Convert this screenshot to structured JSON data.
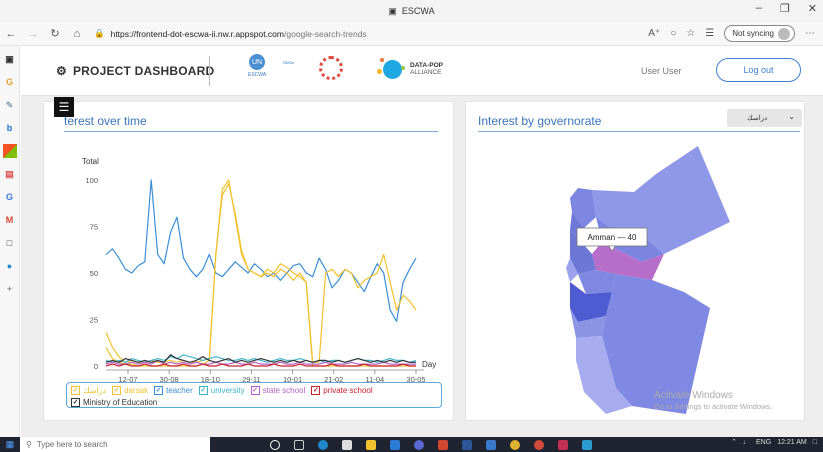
{
  "browser": {
    "tab_title": "ESCWA",
    "url_host": "https://frontend-dot-escwa-ii.nw.r.appspot.com",
    "url_path": "/google-search-trends",
    "not_syncing": "Not syncing"
  },
  "header": {
    "brand": "PROJECT DASHBOARD",
    "dp_title": "DATA-POP",
    "dp_sub": "ALLIANCE",
    "user": "User User",
    "logout": "Log out"
  },
  "card_time": {
    "title": "terest over time"
  },
  "card_gov": {
    "title": "Interest by governorate",
    "select_value": "دراسك",
    "tooltip": "Amman — 40"
  },
  "watermark": {
    "title": "Activate Windows",
    "sub": "Go to Settings to activate Windows."
  },
  "taskbar": {
    "search_placeholder": "Type here to search",
    "time": "12:21 AM",
    "lang": "ENG"
  },
  "colors": {
    "accent": "#3a74b8",
    "teacher": "#3b8fd6",
    "darsak": "#f2c12e",
    "university": "#3fb3c9",
    "state_school": "#b55fc8",
    "private_school": "#c8202f",
    "ministry": "#333333",
    "arabic": "#f2c12e"
  },
  "chart_data": {
    "type": "line",
    "ylabel": "Total",
    "xlabel": "Day",
    "ylim": [
      0,
      100
    ],
    "yticks": [
      0,
      25,
      50,
      75,
      100
    ],
    "x_tick_labels": [
      "12-07",
      "30-08",
      "18-10",
      "29-11",
      "10-01",
      "21-02",
      "11-04",
      "30-05"
    ],
    "legend": [
      "دراسك",
      "darsak",
      "teacher",
      "university",
      "state school",
      "private school",
      "Ministry of Education"
    ],
    "series": [
      {
        "name": "teacher",
        "values": [
          60,
          63,
          58,
          52,
          50,
          54,
          56,
          100,
          60,
          55,
          72,
          80,
          58,
          52,
          48,
          52,
          60,
          50,
          48,
          52,
          56,
          53,
          50,
          55,
          52,
          48,
          50,
          46,
          50,
          54,
          55,
          50,
          48,
          58,
          52,
          42,
          46,
          52,
          50,
          45,
          40,
          48,
          55,
          50,
          30,
          24,
          45,
          52,
          58
        ]
      },
      {
        "name": "دراسك",
        "values": [
          10,
          4,
          2,
          1,
          1,
          0,
          0,
          0,
          0,
          0,
          0,
          0,
          0,
          0,
          0,
          1,
          3,
          60,
          95,
          100,
          80,
          60,
          52,
          50,
          48,
          50,
          48,
          52,
          50,
          46,
          50,
          45,
          0,
          0,
          0,
          0,
          0,
          0,
          0,
          0,
          0,
          0,
          0,
          0,
          0,
          0,
          0,
          0,
          0
        ]
      },
      {
        "name": "darsak",
        "values": [
          18,
          10,
          5,
          2,
          3,
          2,
          2,
          3,
          2,
          2,
          3,
          2,
          3,
          2,
          2,
          3,
          4,
          60,
          92,
          98,
          82,
          62,
          52,
          50,
          48,
          52,
          50,
          55,
          53,
          50,
          48,
          45,
          2,
          2,
          50,
          52,
          48,
          52,
          50,
          42,
          46,
          48,
          50,
          60,
          45,
          30,
          38,
          35,
          30
        ]
      },
      {
        "name": "university",
        "values": [
          3,
          2,
          3,
          2,
          4,
          3,
          2,
          3,
          4,
          3,
          5,
          4,
          6,
          5,
          4,
          3,
          4,
          5,
          4,
          3,
          3,
          4,
          3,
          4,
          3,
          2,
          3,
          4,
          3,
          3,
          4,
          3,
          2,
          3,
          2,
          3,
          3,
          2,
          3,
          4,
          3,
          3,
          2,
          3,
          4,
          3,
          3,
          2,
          3
        ]
      },
      {
        "name": "state school",
        "values": [
          1,
          2,
          1,
          1,
          2,
          1,
          2,
          1,
          3,
          1,
          2,
          1,
          2,
          1,
          2,
          1,
          1,
          2,
          1,
          1,
          2,
          1,
          1,
          2,
          1,
          1,
          1,
          2,
          1,
          1,
          2,
          1,
          1,
          1,
          2,
          1,
          1,
          1,
          2,
          1,
          1,
          1,
          1,
          2,
          1,
          1,
          1,
          1,
          1
        ]
      },
      {
        "name": "private school",
        "values": [
          0,
          1,
          0,
          1,
          0,
          0,
          1,
          0,
          0,
          1,
          0,
          0,
          1,
          0,
          0,
          1,
          0,
          0,
          1,
          0,
          0,
          0,
          1,
          0,
          0,
          0,
          1,
          0,
          0,
          0,
          1,
          0,
          0,
          0,
          0,
          1,
          0,
          0,
          0,
          0,
          1,
          0,
          0,
          0,
          0,
          0,
          1,
          0,
          0
        ]
      },
      {
        "name": "Ministry of Education",
        "values": [
          2,
          3,
          2,
          4,
          3,
          2,
          3,
          2,
          3,
          2,
          6,
          4,
          3,
          2,
          3,
          5,
          3,
          2,
          3,
          4,
          2,
          3,
          2,
          3,
          4,
          3,
          2,
          3,
          2,
          3,
          2,
          3,
          2,
          3,
          3,
          2,
          3,
          2,
          3,
          4,
          3,
          2,
          3,
          2,
          3,
          2,
          3,
          2,
          2
        ]
      }
    ]
  }
}
